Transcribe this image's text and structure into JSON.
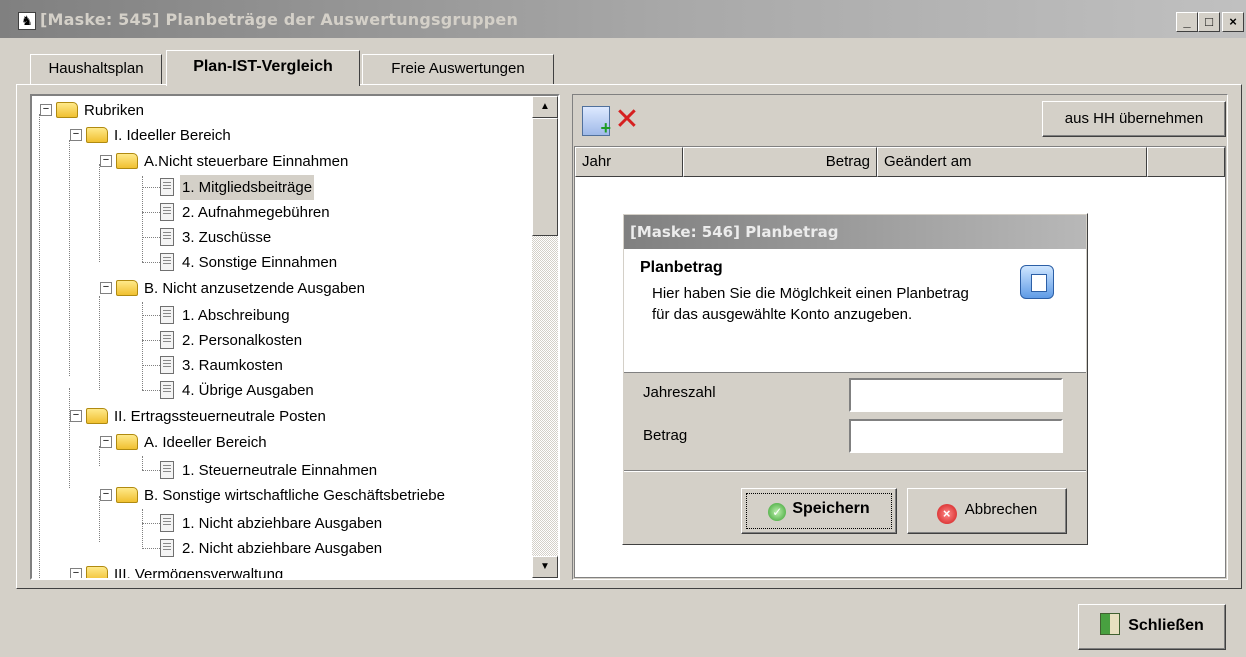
{
  "window": {
    "title": "[Maske: 545] Planbeträge der Auswertungsgruppen",
    "minimize_glyph": "_",
    "maximize_glyph": "□",
    "close_glyph": "×"
  },
  "tabs": [
    {
      "label": "Haushaltsplan"
    },
    {
      "label": "Plan-IST-Vergleich",
      "active": true
    },
    {
      "label": "Freie Auswertungen"
    }
  ],
  "tree": {
    "rows": [
      {
        "label": "Rubriken",
        "type": "folder",
        "level": 0
      },
      {
        "label": "I. Ideeller Bereich",
        "type": "folder",
        "level": 1
      },
      {
        "label": "A.Nicht steuerbare Einnahmen",
        "type": "folder",
        "level": 2
      },
      {
        "label": "1. Mitgliedsbeiträge",
        "type": "doc",
        "level": 3,
        "selected": true
      },
      {
        "label": "2. Aufnahmegebühren",
        "type": "doc",
        "level": 3
      },
      {
        "label": "3. Zuschüsse",
        "type": "doc",
        "level": 3
      },
      {
        "label": "4. Sonstige Einnahmen",
        "type": "doc",
        "level": 3
      },
      {
        "label": "B. Nicht anzusetzende Ausgaben",
        "type": "folder",
        "level": 2
      },
      {
        "label": "1. Abschreibung",
        "type": "doc",
        "level": 3
      },
      {
        "label": "2. Personalkosten",
        "type": "doc",
        "level": 3
      },
      {
        "label": "3. Raumkosten",
        "type": "doc",
        "level": 3
      },
      {
        "label": "4. Übrige Ausgaben",
        "type": "doc",
        "level": 3
      },
      {
        "label": "II. Ertragssteuerneutrale Posten",
        "type": "folder",
        "level": 1
      },
      {
        "label": "A. Ideeller Bereich",
        "type": "folder",
        "level": 2
      },
      {
        "label": "1. Steuerneutrale Einnahmen",
        "type": "doc",
        "level": 3
      },
      {
        "label": "B. Sonstige wirtschaftliche Geschäftsbetriebe",
        "type": "folder",
        "level": 2
      },
      {
        "label": "1. Nicht abziehbare Ausgaben",
        "type": "doc",
        "level": 3
      },
      {
        "label": "2. Nicht abziehbare Ausgaben",
        "type": "doc",
        "level": 3
      },
      {
        "label": "III. Vermögensverwaltung",
        "type": "folder",
        "level": 1
      }
    ]
  },
  "toolbar": {
    "add_icon": "add-record-icon",
    "delete_icon": "delete-icon",
    "import_label": "aus HH übernehmen"
  },
  "grid": {
    "columns": [
      "Jahr",
      "Betrag",
      "Geändert am",
      ""
    ]
  },
  "dialog": {
    "title": "[Maske: 546] Planbetrag",
    "heading": "Planbetrag",
    "description": "Hier haben Sie die Möglchkeit einen Planbetrag für das ausgewählte Konto anzugeben.",
    "year_label": "Jahreszahl",
    "year_value": "",
    "amount_label": "Betrag",
    "amount_value": "",
    "save_label": "Speichern",
    "cancel_label": "Abbrechen"
  },
  "footer": {
    "close_label": "Schließen"
  }
}
